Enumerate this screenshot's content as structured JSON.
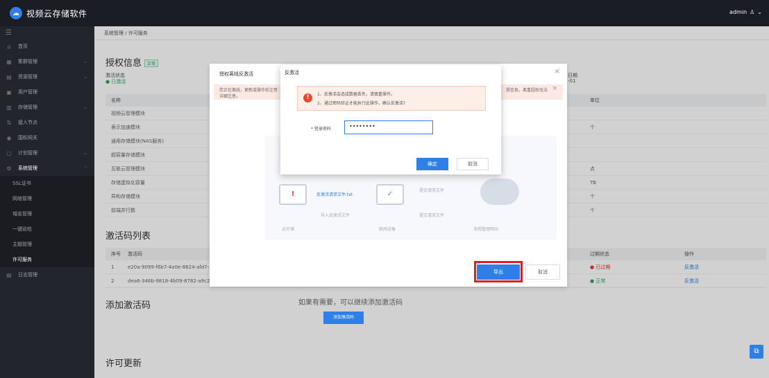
{
  "app": {
    "title": "视频云存储软件",
    "user": "admin"
  },
  "breadcrumb": "系统管理 / 许可服务",
  "sidebar": {
    "items": [
      {
        "label": "首页",
        "icon": "home-icon",
        "caret": false
      },
      {
        "label": "集群管理",
        "icon": "cluster-icon",
        "caret": true
      },
      {
        "label": "资源管理",
        "icon": "resource-icon",
        "caret": true
      },
      {
        "label": "用户管理",
        "icon": "user-icon",
        "caret": false
      },
      {
        "label": "存储管理",
        "icon": "storage-icon",
        "caret": true
      },
      {
        "label": "接入节点",
        "icon": "node-icon",
        "caret": false
      },
      {
        "label": "国标网关",
        "icon": "gateway-icon",
        "caret": false
      },
      {
        "label": "计划管理",
        "icon": "plan-icon",
        "caret": true
      },
      {
        "label": "系统管理",
        "icon": "system-icon",
        "caret": true
      }
    ],
    "subitems": [
      "SSL证书",
      "网络管理",
      "域名管理",
      "一键巡检",
      "主题管理",
      "许可服务"
    ],
    "last_item": {
      "label": "日志管理",
      "icon": "log-icon"
    }
  },
  "license": {
    "title": "授权信息",
    "badge": "正常",
    "status_label": "激活状态",
    "status_value": "● 已激活",
    "expire_label": "日期",
    "expire_value": "-01",
    "table_head": [
      "名称",
      "单位"
    ],
    "rows": [
      {
        "name": "视频云管理模块",
        "unit": ""
      },
      {
        "name": "表示加速模块",
        "unit": "个"
      },
      {
        "name": "通用存储模块(NAS服务)",
        "unit": ""
      },
      {
        "name": "超容量存储模块",
        "unit": ""
      },
      {
        "name": "互联云管理模块",
        "unit": "点"
      },
      {
        "name": "存储虚拟化容量",
        "unit": "TB"
      },
      {
        "name": "异构存储模块",
        "unit": "个"
      },
      {
        "name": "前端并行数",
        "unit": "个"
      }
    ]
  },
  "activation": {
    "title": "激活码列表",
    "head": [
      "序号",
      "激活码",
      "过期状态",
      "操作"
    ],
    "rows": [
      {
        "no": "1",
        "code": "e20a-9099-f6b7-4a0e-8624-afd7-2e38-",
        "state": "● 已过期",
        "action": "反激活"
      },
      {
        "no": "2",
        "code": "dea6-348b-9818-4b09-8782-a9c2-a06d",
        "state": "● 正常",
        "action": "反激活"
      }
    ]
  },
  "add_section": {
    "title": "添加激活码",
    "hint": "如果有需要，可以继续添加激活码",
    "button": "添加激活码"
  },
  "update_section": {
    "title": "许可更新"
  },
  "outer_dialog": {
    "title": "授权离线反激活",
    "notice1": "您正在离线，更新或操作前注意",
    "notice2": "详细注意。",
    "notice_tail": "授信息，离重超权无法",
    "flow_file": "反激活请求文件.txt",
    "flow_import": "导入反激活文件",
    "flow_submit": "提交请求文件",
    "node1": "云存储",
    "node2": "联网设备",
    "node3": "海视管理网站",
    "flow_top": "提交请求文件",
    "export": "导出",
    "cancel": "取消"
  },
  "inner_dialog": {
    "title": "反激活",
    "line1": "1、反激活会造成数据丢失，请慎重操作。",
    "line2": "2、通过密码验证才能执行此操作，确认反激活?",
    "pwd_label": "* 登录密码",
    "pwd_value": "••••••••",
    "ok": "确定",
    "cancel": "取消"
  }
}
